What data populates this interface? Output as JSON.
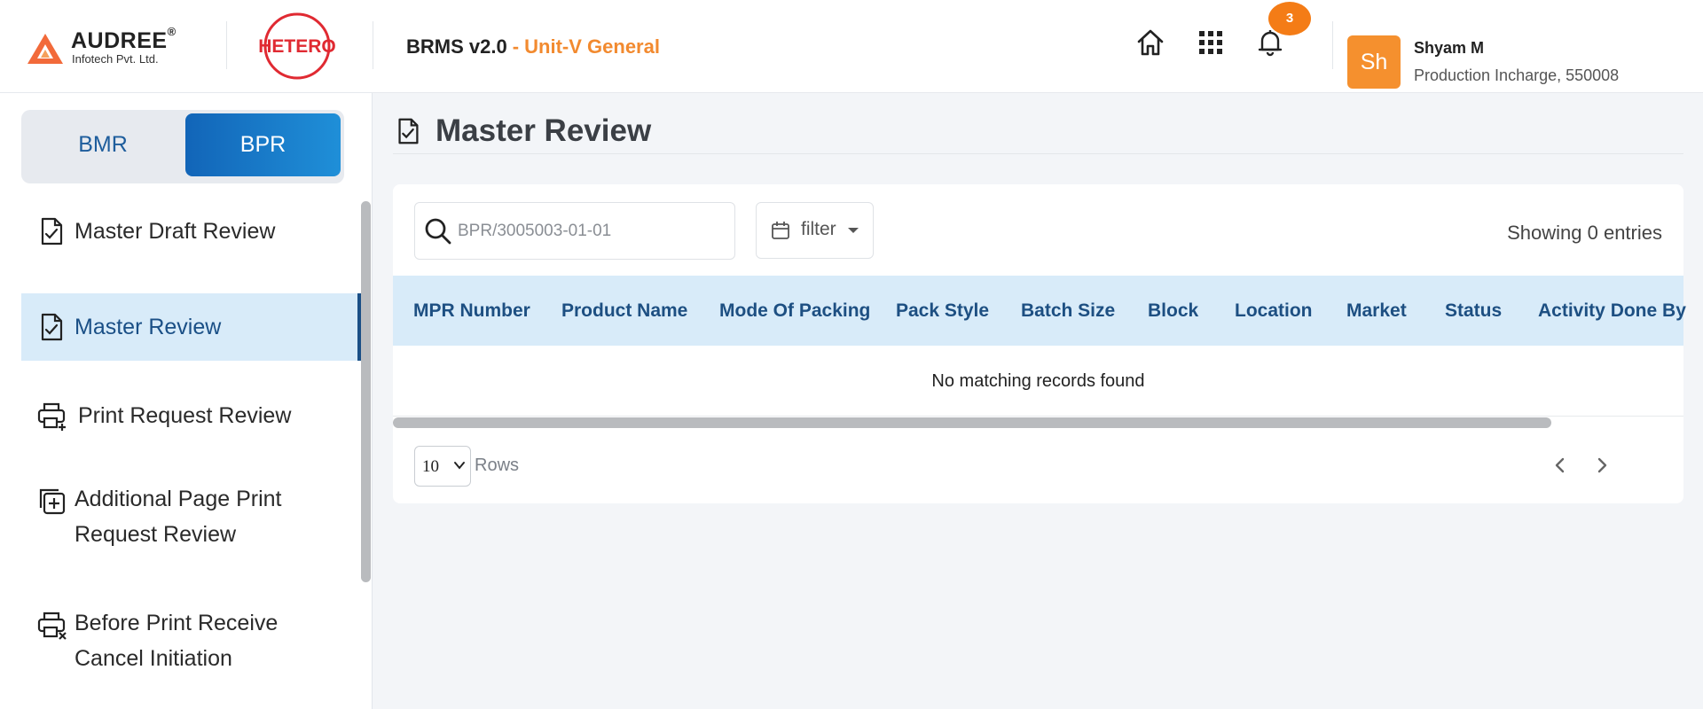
{
  "header": {
    "company_name": "AUDREE",
    "company_reg": "®",
    "company_sub": "Infotech Pvt. Ltd.",
    "partner_logo_text": "HETERO",
    "app_name": "BRMS v2.0",
    "app_unit": "- Unit-V General",
    "notification_count": "3",
    "icons": [
      "home-icon",
      "apps-grid-icon",
      "bell-icon"
    ],
    "accent_color": "#f28a2f"
  },
  "user": {
    "initials": "Sh",
    "name": "Shyam M",
    "role": "Production Incharge, 550008"
  },
  "sidebar": {
    "segment": {
      "options": [
        "BMR",
        "BPR"
      ],
      "selected": "BPR"
    },
    "items": [
      {
        "label": "Master Draft Review",
        "icon": "document-check-icon",
        "active": false
      },
      {
        "label": "Master Review",
        "icon": "document-check-icon",
        "active": true
      },
      {
        "label": "Print Request Review",
        "icon": "printer-plus-icon",
        "active": false
      },
      {
        "label": "Additional Page Print",
        "label2": "Request Review",
        "icon": "copy-plus-icon",
        "active": false
      },
      {
        "label": "Before Print Receive",
        "label2": "Cancel Initiation",
        "icon": "printer-x-icon",
        "active": false
      }
    ]
  },
  "main": {
    "title": "Master Review",
    "search": {
      "placeholder": "BPR/3005003-01-01",
      "value": ""
    },
    "filter_label": "filter",
    "showing_text": "Showing 0 entries",
    "columns": [
      "MPR Number",
      "Product Name",
      "Mode Of Packing",
      "Pack Style",
      "Batch Size",
      "Block",
      "Location",
      "Market",
      "Status",
      "Activity Done By"
    ],
    "empty_text": "No matching records found",
    "rows_per_page": "10",
    "rows_label": "Rows"
  }
}
